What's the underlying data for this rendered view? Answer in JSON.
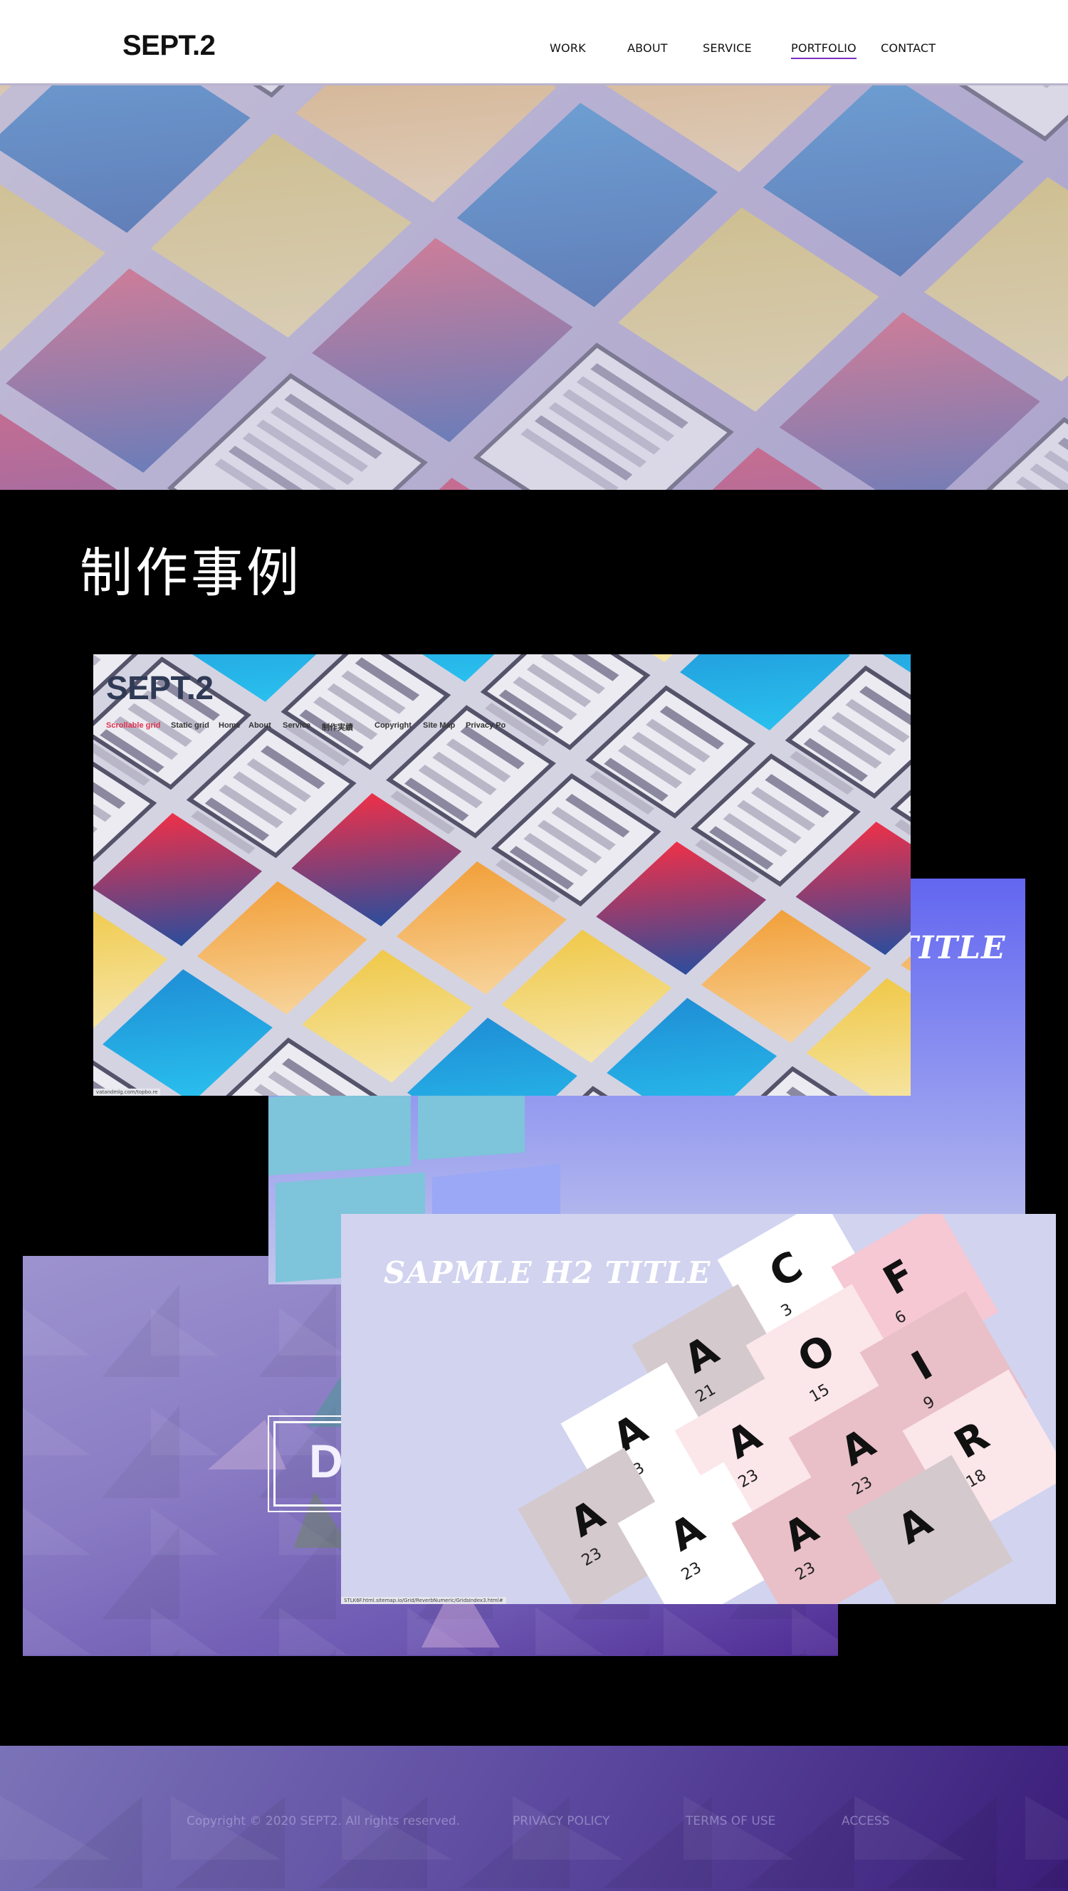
{
  "header": {
    "logo": "SEPT.2",
    "nav": [
      {
        "label": "WORK",
        "active": false
      },
      {
        "label": "ABOUT",
        "active": false
      },
      {
        "label": "SERVICE",
        "active": false
      },
      {
        "label": "PORTFOLIO",
        "active": true
      },
      {
        "label": "CONTACT",
        "active": false
      }
    ],
    "accent_color": "#7b2fc4"
  },
  "main": {
    "title": "制作事例",
    "cards": {
      "sept": {
        "logo": "SEPT.2",
        "nav": [
          "Scrollable grid",
          "Static grid",
          "Home",
          "About",
          "Service",
          "制作実績",
          "Copyright",
          "Site Map",
          "Privacy Po"
        ],
        "active_nav_color": "#e0314f",
        "url": "vatandmlg.com/topbo.re"
      },
      "blue": {
        "title": "TITLE"
      },
      "poly": {
        "letter": "D"
      },
      "grid": {
        "title": "SAPMLE H2 TITLE",
        "url": "STLK6F.html.sitemap.io/Grid/ReverbNumeric/GridsIndex3.html#",
        "cells": [
          {
            "glyph": "C",
            "num": "3"
          },
          {
            "glyph": "F",
            "num": "6"
          },
          {
            "glyph": "A",
            "num": "21"
          },
          {
            "glyph": "O",
            "num": "15"
          },
          {
            "glyph": "I",
            "num": "9"
          },
          {
            "glyph": "A",
            "num": "23"
          },
          {
            "glyph": "A",
            "num": "23"
          },
          {
            "glyph": "A",
            "num": "23"
          },
          {
            "glyph": "R",
            "num": "18"
          },
          {
            "glyph": "A",
            "num": "23"
          },
          {
            "glyph": "A",
            "num": "23"
          },
          {
            "glyph": "A",
            "num": "23"
          },
          {
            "glyph": "A",
            "num": ""
          }
        ]
      }
    }
  },
  "footer": {
    "copyright": "Copyright © 2020 SEPT2. All rights reserved.",
    "links": [
      "PRIVACY POLICY",
      "TERMS OF USE",
      "ACCESS"
    ]
  }
}
